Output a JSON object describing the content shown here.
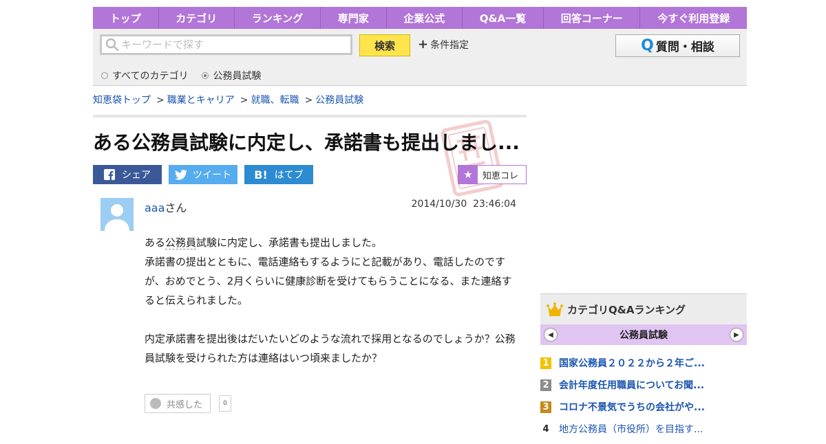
{
  "nav": [
    "トップ",
    "カテゴリ",
    "ランキング",
    "専門家",
    "企業公式",
    "Q&A一覧",
    "回答コーナー",
    "今すぐ利用登録"
  ],
  "search": {
    "placeholder": "キーワードで探す",
    "button": "検索",
    "condition": "条件指定",
    "ask_button": "質問・相談",
    "ask_icon": "Q",
    "radio_all": "すべてのカテゴリ",
    "radio_current": "公務員試験"
  },
  "breadcrumbs": [
    "知恵袋トップ",
    "職業とキャリア",
    "就職、転職",
    "公務員試験"
  ],
  "question": {
    "title": "ある公務員試験に内定し、承諾書も提出しまし...",
    "share_fb": "シェア",
    "share_tw": "ツイート",
    "share_hb": "はてブ",
    "hatena_icon": "B!",
    "chiecore": "知恵コレ",
    "user_name": "aaa",
    "user_suffix": "さん",
    "datetime": "2014/10/30  23:46:04",
    "line1_pre": "ある",
    "line1_kw": "公務員",
    "line1_post": "試験に内定し、承諾書も提出しました。",
    "line2": "承諾書の提出とともに、電話連絡もするようにと記載があり、電話したのですが、おめでとう、2月くらいに健康診断を受けてもらうことになる、また連絡すると伝えられました。",
    "line3": "内定承諾書を提出後はだいたいどのような流れで採用となるのでしょうか？公務員試験を受けられた方は連絡はいつ頃来ましたか？",
    "empathy": "共感した",
    "empathy_count": "0"
  },
  "ranking": {
    "title": "カテゴリQ&Aランキング",
    "category": "公務員試験",
    "items": [
      {
        "rank": "1",
        "text": "国家公務員２０２２から２年ご...",
        "color": "#f2c200"
      },
      {
        "rank": "2",
        "text": "会計年度任用職員についてお聞...",
        "color": "#8c8c8c"
      },
      {
        "rank": "3",
        "text": "コロナ不景気でうちの会社がや...",
        "color": "#c68a1a"
      },
      {
        "rank": "4",
        "text": "地方公務員（市役所）を目指す...",
        "color": ""
      }
    ]
  },
  "colors": {
    "brand": "#b275d8",
    "link": "#1a55b0",
    "search_button": "#ffe44d"
  }
}
